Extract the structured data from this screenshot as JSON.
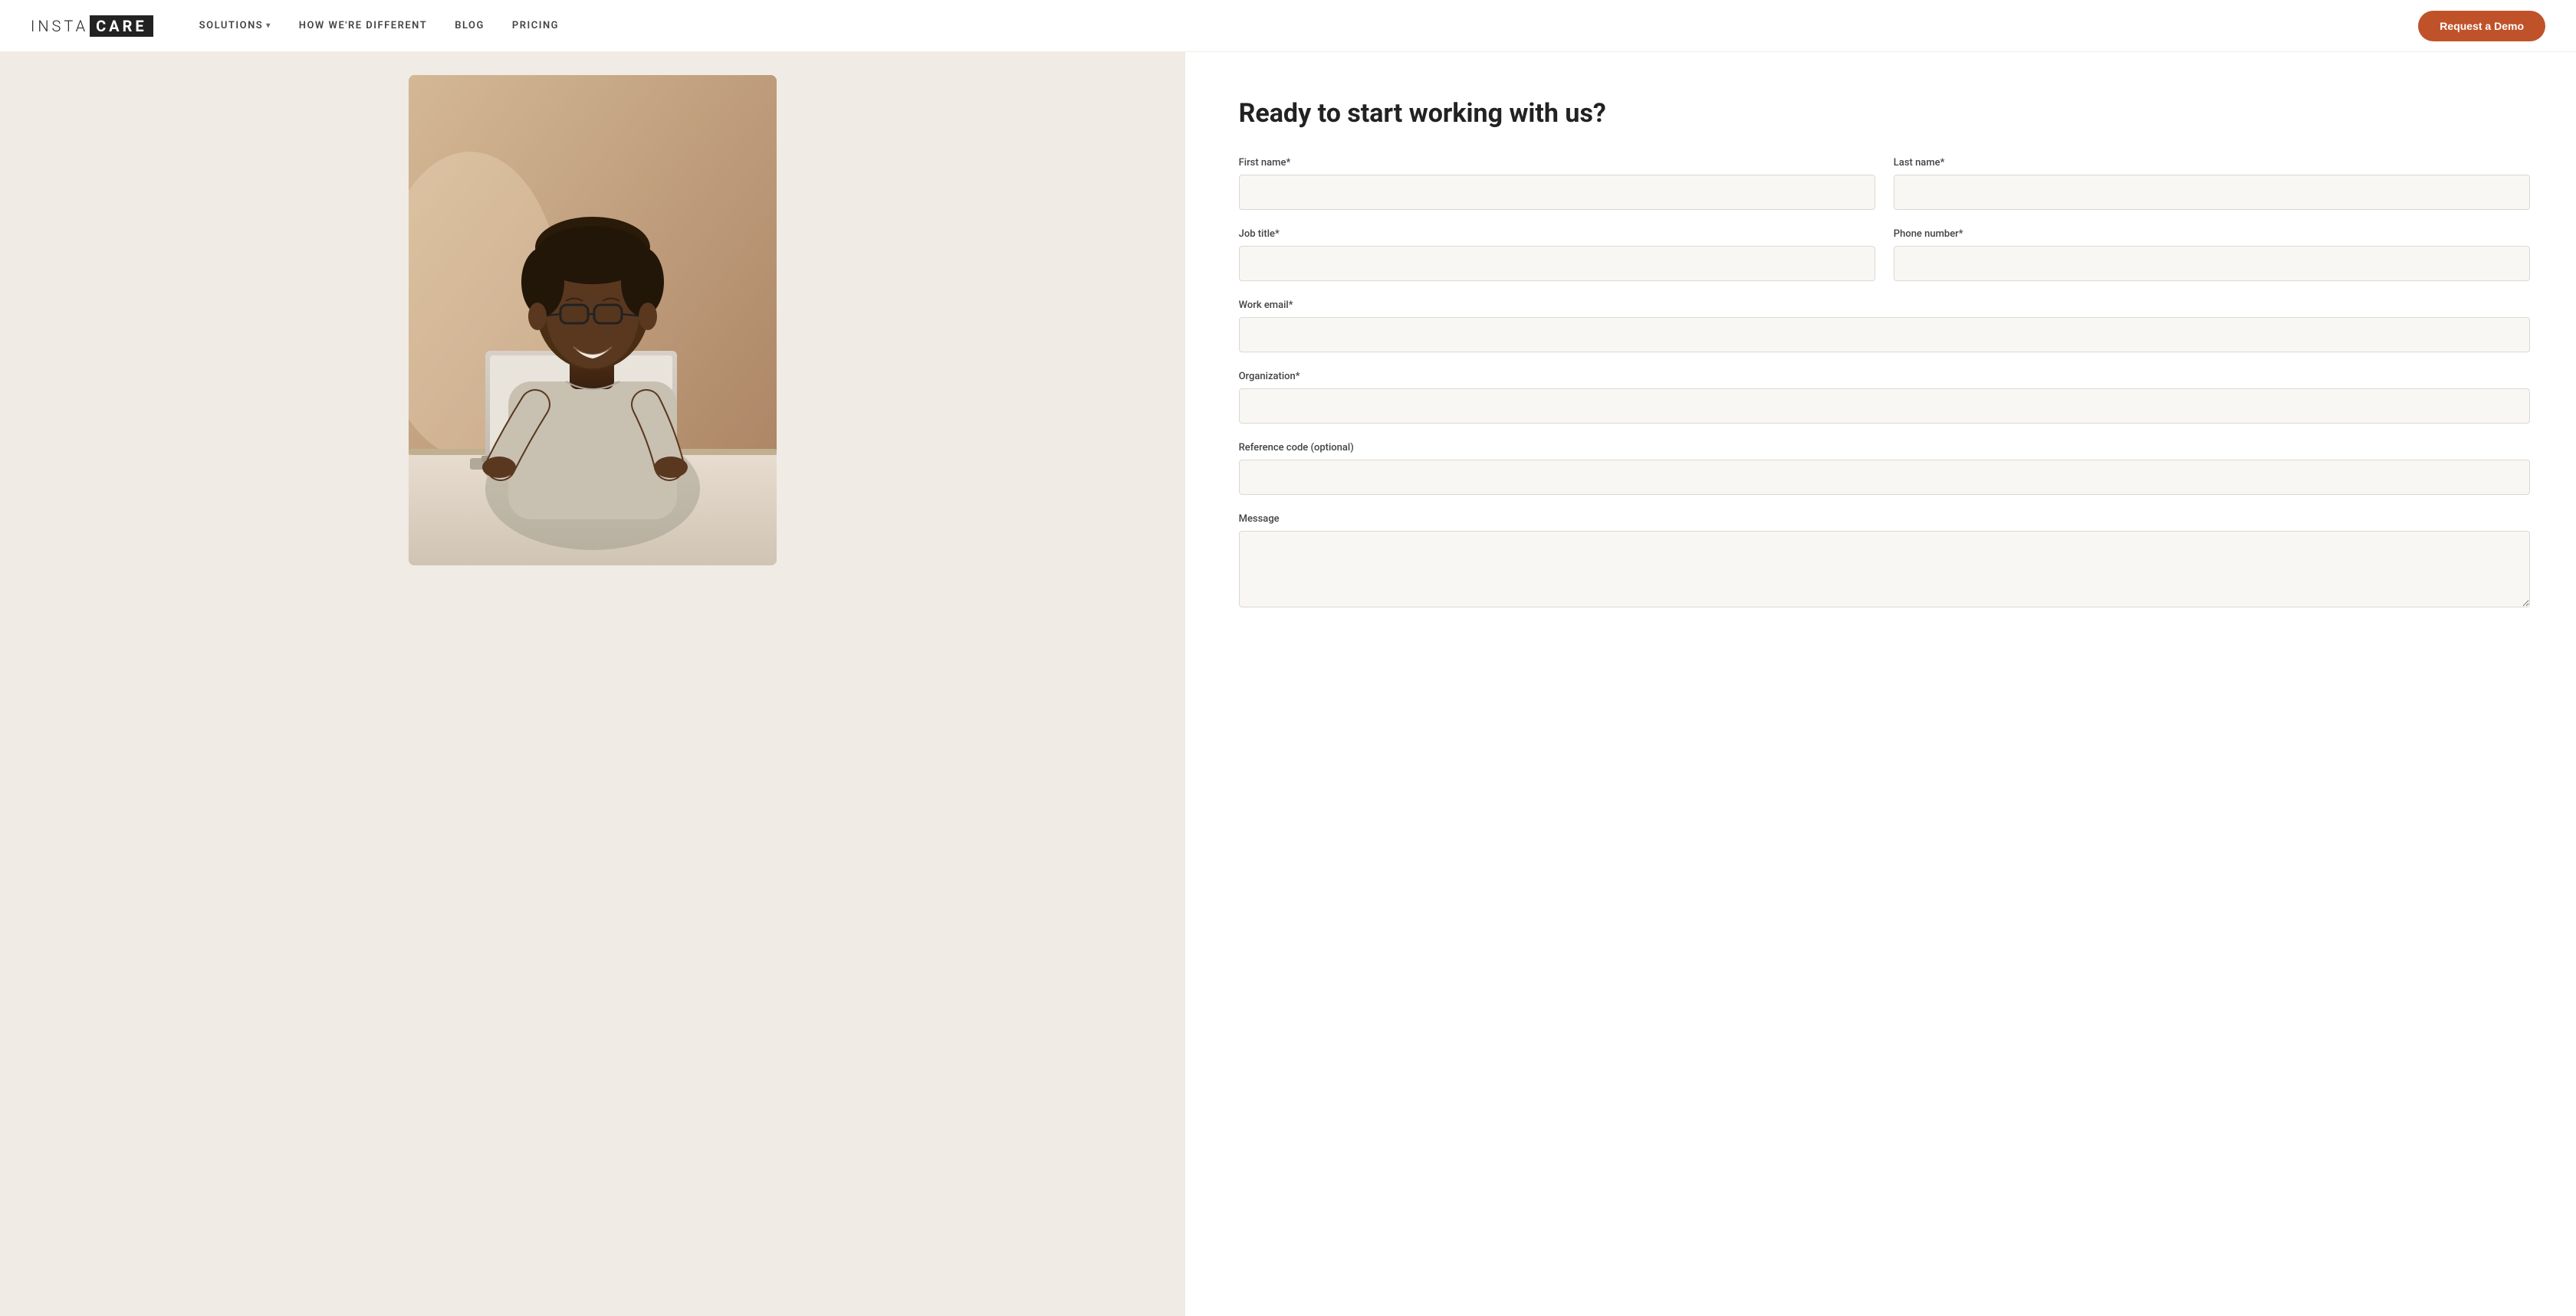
{
  "navbar": {
    "logo_insta": "INSTA",
    "logo_care": "CARE",
    "nav_items": [
      {
        "id": "solutions",
        "label": "SOLUTIONS",
        "has_dropdown": true
      },
      {
        "id": "how-different",
        "label": "HOW WE'RE DIFFERENT",
        "has_dropdown": false
      },
      {
        "id": "blog",
        "label": "BLOG",
        "has_dropdown": false
      },
      {
        "id": "pricing",
        "label": "PRICING",
        "has_dropdown": false
      }
    ],
    "cta_label": "Request a Demo"
  },
  "form": {
    "title": "Ready to start working with us?",
    "fields": {
      "first_name_label": "First name*",
      "last_name_label": "Last name*",
      "job_title_label": "Job title*",
      "phone_label": "Phone number*",
      "email_label": "Work email*",
      "organization_label": "Organization*",
      "reference_label": "Reference code (optional)",
      "message_label": "Message"
    }
  },
  "colors": {
    "accent": "#c0522a",
    "bg_left": "#f0ebe4",
    "bg_form": "#ffffff",
    "input_bg": "#f9f7f4",
    "text_dark": "#222222",
    "nav_text": "#444444"
  }
}
